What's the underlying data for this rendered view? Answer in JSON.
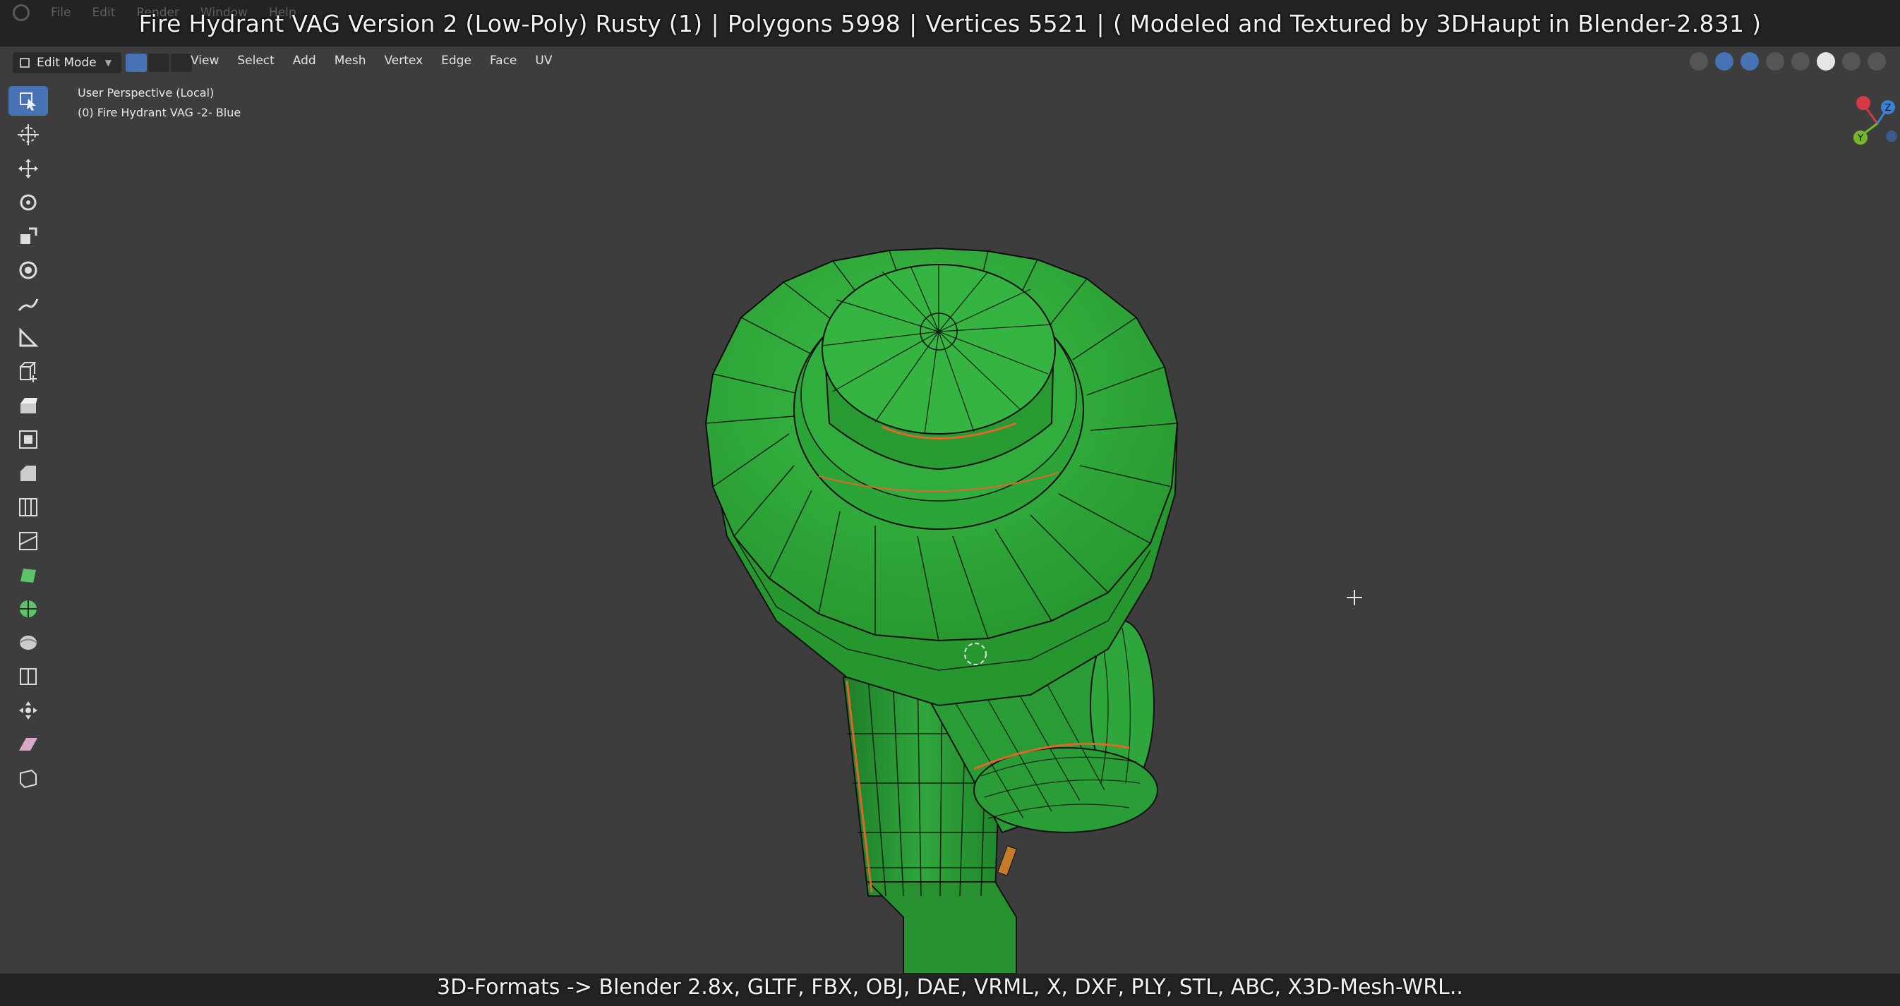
{
  "app": {
    "menus": [
      "File",
      "Edit",
      "Render",
      "Window",
      "Help"
    ]
  },
  "overlay_title": {
    "segments": [
      "Fire Hydrant VAG Version 2 (Low-Poly) Rusty (1)",
      "Polygons 5998",
      "Vertices 5521",
      "( Modeled and Textured by 3DHaupt in Blender-2.831 )"
    ]
  },
  "header": {
    "mode": "Edit Mode",
    "menu": [
      "View",
      "Select",
      "Add",
      "Mesh",
      "Vertex",
      "Edge",
      "Face",
      "UV"
    ]
  },
  "viewport": {
    "perspective": "User Perspective (Local)",
    "object": "(0) Fire Hydrant VAG -2- Blue"
  },
  "gizmo": {
    "x": "X",
    "y": "Y",
    "z": "Z"
  },
  "tools": [
    {
      "name": "select-box-tool",
      "icon": "select-box-icon",
      "active": true
    },
    {
      "name": "cursor-tool",
      "icon": "cursor-icon",
      "active": false
    },
    {
      "name": "move-tool",
      "icon": "move-icon",
      "active": false
    },
    {
      "name": "rotate-tool",
      "icon": "rotate-icon",
      "active": false
    },
    {
      "name": "scale-tool",
      "icon": "scale-icon",
      "active": false
    },
    {
      "name": "transform-tool",
      "icon": "transform-icon",
      "active": false
    },
    {
      "name": "annotate-tool",
      "icon": "annotate-icon",
      "active": false
    },
    {
      "name": "measure-tool",
      "icon": "measure-icon",
      "active": false
    },
    {
      "name": "add-cube-tool",
      "icon": "add-cube-icon",
      "active": false
    },
    {
      "name": "extrude-tool",
      "icon": "extrude-icon",
      "active": false
    },
    {
      "name": "inset-tool",
      "icon": "inset-icon",
      "active": false
    },
    {
      "name": "bevel-tool",
      "icon": "bevel-icon",
      "active": false
    },
    {
      "name": "loop-cut-tool",
      "icon": "loop-cut-icon",
      "active": false
    },
    {
      "name": "knife-tool",
      "icon": "knife-icon",
      "active": false
    },
    {
      "name": "poly-build-tool",
      "icon": "poly-build-icon",
      "active": false
    },
    {
      "name": "spin-tool",
      "icon": "spin-icon",
      "active": false
    },
    {
      "name": "smooth-tool",
      "icon": "smooth-icon",
      "active": false
    },
    {
      "name": "edge-slide-tool",
      "icon": "edge-slide-icon",
      "active": false
    },
    {
      "name": "shrink-fatten-tool",
      "icon": "shrink-fatten-icon",
      "active": false
    },
    {
      "name": "shear-tool",
      "icon": "shear-icon",
      "active": false
    },
    {
      "name": "rip-region-tool",
      "icon": "rip-region-icon",
      "active": false
    }
  ],
  "bottom_overlay": "3D-Formats -> Blender 2.8x, GLTF, FBX, OBJ, DAE, VRML, X, DXF, PLY, STL, ABC, X3D-Mesh-WRL..",
  "colors": {
    "mesh_face": "#2fa63c",
    "mesh_edge": "#111111",
    "seam": "#e0662a",
    "accent": "#4772b3",
    "viewport_bg": "#3d3d3d"
  }
}
